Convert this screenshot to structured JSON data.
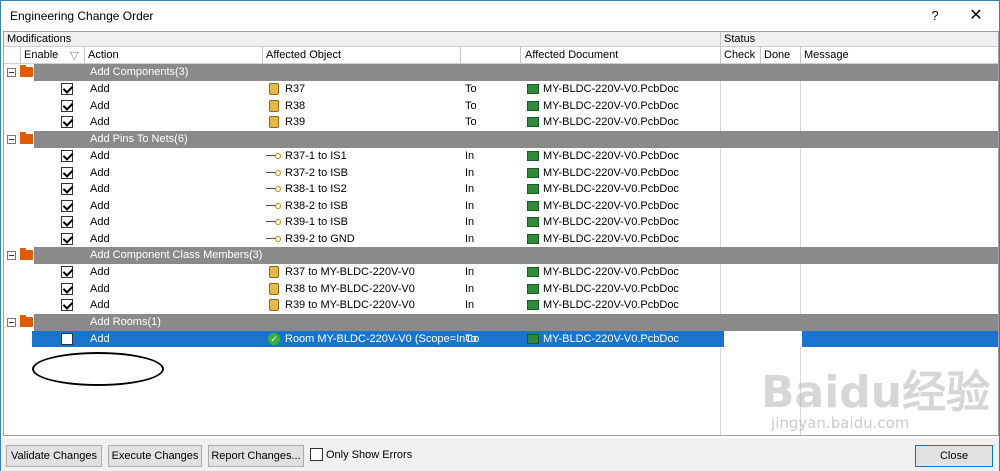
{
  "window": {
    "title": "Engineering Change Order",
    "help": "?",
    "close": "✕"
  },
  "header": {
    "modifications": "Modifications",
    "status": "Status",
    "columns": {
      "enable": "Enable",
      "action": "Action",
      "affected_object": "Affected Object",
      "affected_document": "Affected Document",
      "check": "Check",
      "done": "Done",
      "message": "Message"
    }
  },
  "groups": [
    {
      "label": "Add Components(3)"
    },
    {
      "label": "Add Pins To Nets(6)"
    },
    {
      "label": "Add Component Class Members(3)"
    },
    {
      "label": "Add Rooms(1)"
    }
  ],
  "rows": [
    {
      "enabled": true,
      "action": "Add",
      "object": "R37",
      "dir": "To",
      "doc": "MY-BLDC-220V-V0.PcbDoc",
      "icon": "component-icon"
    },
    {
      "enabled": true,
      "action": "Add",
      "object": "R38",
      "dir": "To",
      "doc": "MY-BLDC-220V-V0.PcbDoc",
      "icon": "component-icon"
    },
    {
      "enabled": true,
      "action": "Add",
      "object": "R39",
      "dir": "To",
      "doc": "MY-BLDC-220V-V0.PcbDoc",
      "icon": "component-icon"
    },
    {
      "enabled": true,
      "action": "Add",
      "object": "R37-1 to IS1",
      "dir": "In",
      "doc": "MY-BLDC-220V-V0.PcbDoc",
      "icon": "pin-net-icon"
    },
    {
      "enabled": true,
      "action": "Add",
      "object": "R37-2 to ISB",
      "dir": "In",
      "doc": "MY-BLDC-220V-V0.PcbDoc",
      "icon": "pin-net-icon"
    },
    {
      "enabled": true,
      "action": "Add",
      "object": "R38-1 to IS2",
      "dir": "In",
      "doc": "MY-BLDC-220V-V0.PcbDoc",
      "icon": "pin-net-icon"
    },
    {
      "enabled": true,
      "action": "Add",
      "object": "R38-2 to ISB",
      "dir": "In",
      "doc": "MY-BLDC-220V-V0.PcbDoc",
      "icon": "pin-net-icon"
    },
    {
      "enabled": true,
      "action": "Add",
      "object": "R39-1 to ISB",
      "dir": "In",
      "doc": "MY-BLDC-220V-V0.PcbDoc",
      "icon": "pin-net-icon"
    },
    {
      "enabled": true,
      "action": "Add",
      "object": "R39-2 to GND",
      "dir": "In",
      "doc": "MY-BLDC-220V-V0.PcbDoc",
      "icon": "pin-net-icon"
    },
    {
      "enabled": true,
      "action": "Add",
      "object": "R37 to MY-BLDC-220V-V0",
      "dir": "In",
      "doc": "MY-BLDC-220V-V0.PcbDoc",
      "icon": "component-icon"
    },
    {
      "enabled": true,
      "action": "Add",
      "object": "R38 to MY-BLDC-220V-V0",
      "dir": "In",
      "doc": "MY-BLDC-220V-V0.PcbDoc",
      "icon": "component-icon"
    },
    {
      "enabled": true,
      "action": "Add",
      "object": "R39 to MY-BLDC-220V-V0",
      "dir": "In",
      "doc": "MY-BLDC-220V-V0.PcbDoc",
      "icon": "component-icon"
    },
    {
      "enabled": false,
      "action": "Add",
      "object": "Room MY-BLDC-220V-V0 (Scope=InCo",
      "dir": "To",
      "doc": "MY-BLDC-220V-V0.PcbDoc",
      "icon": "room-icon"
    }
  ],
  "buttons": {
    "validate": "Validate Changes",
    "execute": "Execute Changes",
    "report": "Report Changes...",
    "only_errors": "Only Show Errors",
    "close": "Close"
  },
  "watermark": {
    "brand": "Baidu经验",
    "url": "jingyan.baidu.com"
  }
}
